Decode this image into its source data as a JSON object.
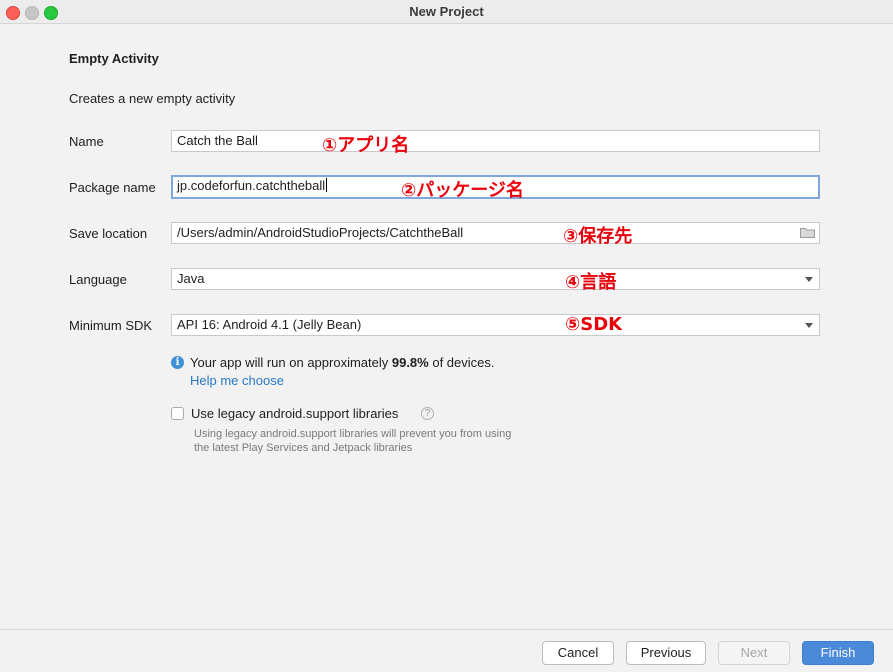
{
  "window": {
    "title": "New Project"
  },
  "page": {
    "heading": "Empty Activity",
    "description": "Creates a new empty activity"
  },
  "form": {
    "name": {
      "label": "Name",
      "value": "Catch the Ball",
      "annotation": "①アプリ名"
    },
    "package": {
      "label": "Package name",
      "value": "jp.codeforfun.catchtheball",
      "annotation": "②パッケージ名"
    },
    "save_location": {
      "label": "Save location",
      "value": "/Users/admin/AndroidStudioProjects/CatchtheBall",
      "annotation": "③保存先",
      "icon": "folder-icon"
    },
    "language": {
      "label": "Language",
      "value": "Java",
      "annotation": "④言語"
    },
    "min_sdk": {
      "label": "Minimum SDK",
      "value": "API 16: Android 4.1 (Jelly Bean)",
      "annotation": "⑤SDK"
    }
  },
  "info": {
    "icon": "info-icon",
    "text_before": "Your app will run on approximately ",
    "percent": "99.8%",
    "text_after": " of devices.",
    "help_link": "Help me choose"
  },
  "legacy": {
    "checkbox_label": "Use legacy android.support libraries",
    "checked": false,
    "hint_line1": "Using legacy android.support libraries will prevent you from using",
    "hint_line2": "the latest Play Services and Jetpack libraries"
  },
  "buttons": {
    "cancel": "Cancel",
    "previous": "Previous",
    "next": "Next",
    "finish": "Finish"
  },
  "colors": {
    "annotation": "#e8000b",
    "primary_button": "#4a8ad8",
    "link": "#2a78c5"
  }
}
